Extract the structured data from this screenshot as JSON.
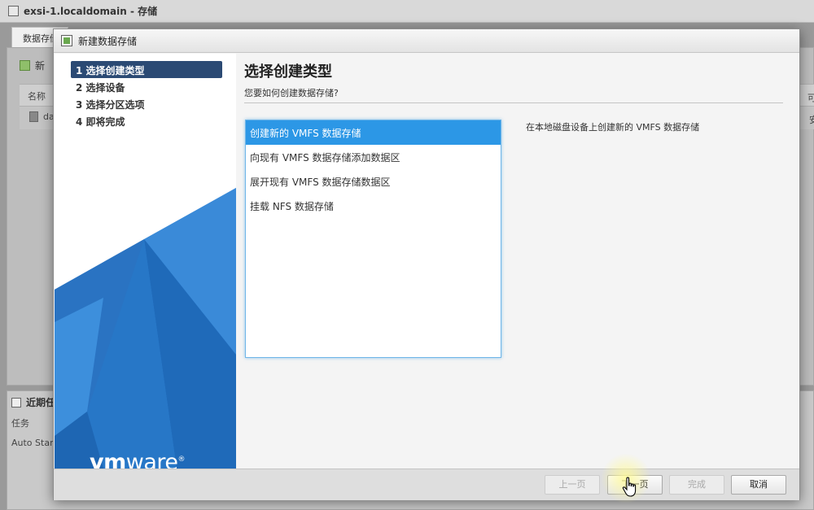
{
  "host": {
    "window_title": "exsi-1.localdomain - 存储",
    "tab_label": "数据存储",
    "toolbar_label": "新",
    "col_name": "名称",
    "row_name": "da",
    "right_col_a": "可",
    "right_col_b": "安",
    "recent_title": "近期任",
    "recent_col": "任务",
    "recent_cell": "Auto Star"
  },
  "dialog": {
    "title": "新建数据存储",
    "steps": [
      {
        "label": "1 选择创建类型",
        "active": true
      },
      {
        "label": "2 选择设备",
        "active": false
      },
      {
        "label": "3 选择分区选项",
        "active": false
      },
      {
        "label": "4 即将完成",
        "active": false
      }
    ],
    "logo": {
      "vm": "vm",
      "ware": "ware",
      "mark": "®"
    },
    "page_title": "选择创建类型",
    "page_subtitle": "您要如何创建数据存储?",
    "options": [
      {
        "label": "创建新的 VMFS 数据存储",
        "selected": true
      },
      {
        "label": "向现有 VMFS 数据存储添加数据区",
        "selected": false
      },
      {
        "label": "展开现有 VMFS 数据存储数据区",
        "selected": false
      },
      {
        "label": "挂载 NFS 数据存储",
        "selected": false
      }
    ],
    "description": "在本地磁盘设备上创建新的 VMFS 数据存储",
    "buttons": {
      "prev": "上一页",
      "next": "下一页",
      "finish": "完成",
      "cancel": "取消"
    }
  },
  "colors": {
    "step_active": "#2b4a74",
    "option_selected": "#2c97e6",
    "art_blue": "#2f7fd1"
  }
}
